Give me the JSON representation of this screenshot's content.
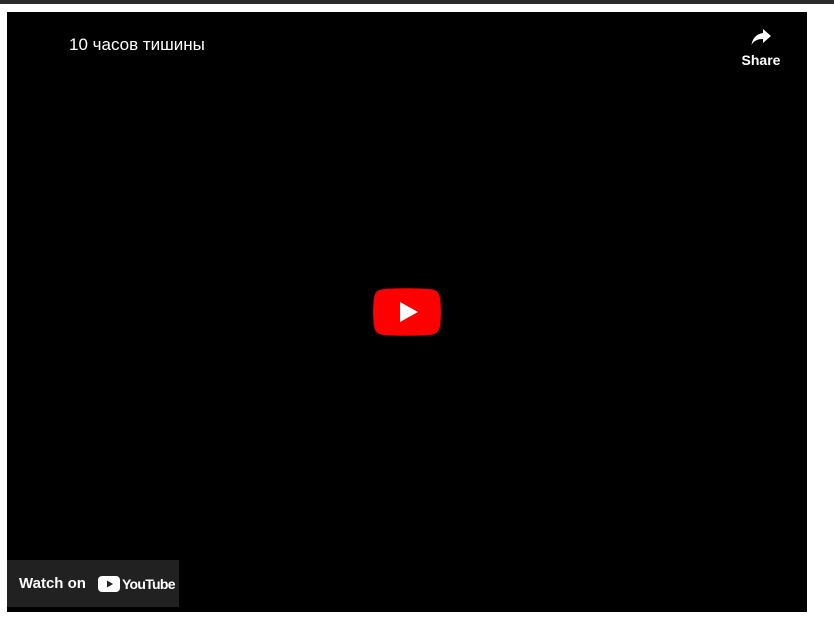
{
  "player": {
    "title": "10 часов тишины",
    "share_label": "Share",
    "watch_on_label": "Watch on",
    "brand_wordmark": "YouTube"
  },
  "icons": {
    "share": "share-arrow-icon",
    "play": "play-icon",
    "brand": "youtube-logo-icon"
  },
  "colors": {
    "background": "#000000",
    "play_button": "#ff0000",
    "watch_on_background": "#212121",
    "text": "#ffffff"
  }
}
